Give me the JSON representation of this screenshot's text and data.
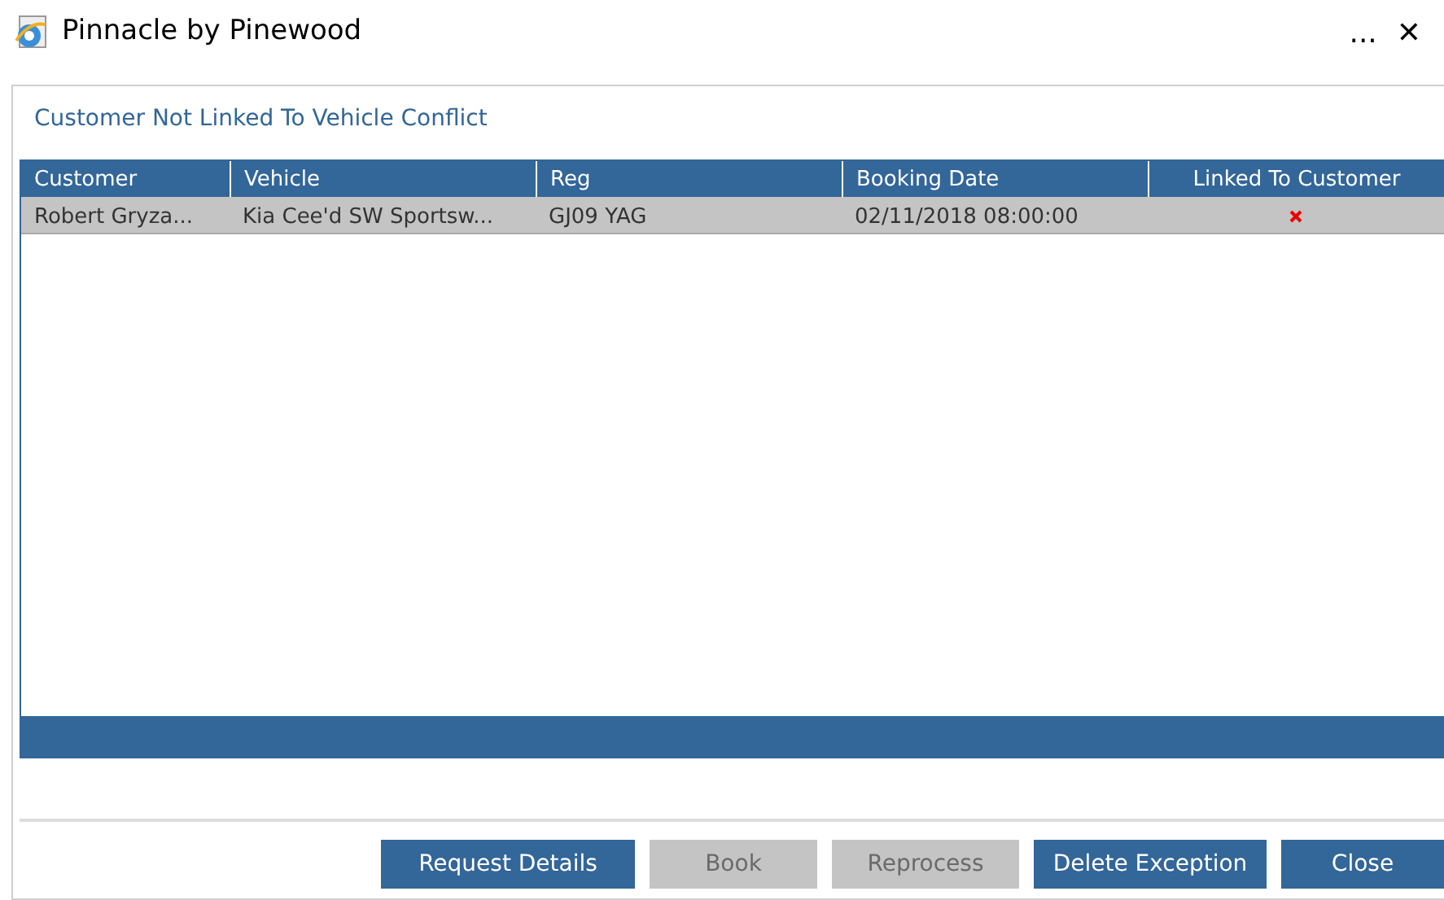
{
  "window": {
    "title": "Pinnacle by Pinewood",
    "menu_glyph": "...",
    "close_glyph": "✕"
  },
  "heading": "Customer Not Linked To Vehicle Conflict",
  "table": {
    "columns": [
      "Customer",
      "Vehicle",
      "Reg",
      "Booking Date",
      "Linked To Customer"
    ],
    "rows": [
      {
        "selected": true,
        "cells": [
          "Robert Gryza...",
          "Kia Cee'd SW Sportsw...",
          "GJ09 YAG",
          "02/11/2018 08:00:00"
        ],
        "linked": false
      }
    ]
  },
  "buttons": [
    {
      "label": "Request Details",
      "disabled": false
    },
    {
      "label": "Book",
      "disabled": true
    },
    {
      "label": "Reprocess",
      "disabled": true
    },
    {
      "label": "Delete Exception",
      "disabled": false
    },
    {
      "label": "Close",
      "disabled": false
    }
  ]
}
